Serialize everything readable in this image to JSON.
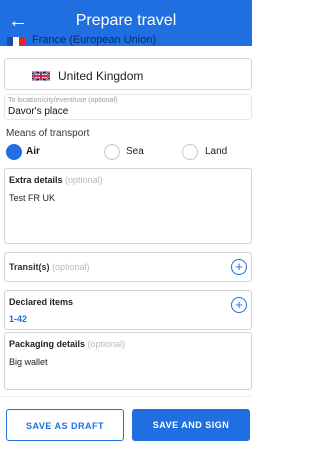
{
  "header": {
    "title": "Prepare travel",
    "origin_country": "France (European Union)"
  },
  "destination": {
    "country": "United Kingdom",
    "to_location_label": "To location/city/event/use (optional)",
    "to_location_value": "Davor's place"
  },
  "transport": {
    "label": "Means of transport",
    "options": [
      {
        "label": "Air",
        "selected": true
      },
      {
        "label": "Sea",
        "selected": false
      },
      {
        "label": "Land",
        "selected": false
      }
    ]
  },
  "extra_details": {
    "label": "Extra details",
    "optional": "(optional)",
    "value": "Test FR UK"
  },
  "transit": {
    "label": "Transit(s)",
    "optional": "(optional)"
  },
  "declared_items": {
    "label": "Declared items",
    "value": "1-42"
  },
  "packaging": {
    "label": "Packaging details",
    "optional": "(optional)",
    "value": "Big wallet"
  },
  "actions": {
    "draft": "SAVE AS DRAFT",
    "sign": "SAVE AND SIGN"
  },
  "colors": {
    "primary": "#1f6fe0"
  }
}
